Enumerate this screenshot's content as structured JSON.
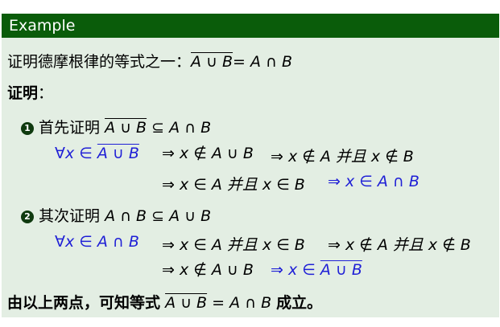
{
  "header": {
    "title": "Example"
  },
  "intro": {
    "text": "证明德摩根律的等式之一：",
    "lhs": "A ∪ B",
    "rhs": "= A ∩ B"
  },
  "proof_label": "证明",
  "proof_colon": "：",
  "step1": {
    "number": "1",
    "text": "首先证明",
    "expr_a": "A ∪ B",
    "expr_b": "⊆ A ∩ B",
    "row1": {
      "forall": "∀x ∈",
      "set": "A ∪ B",
      "impl1": "⇒ x ∉ A ∪ B",
      "impl2": "⇒ x ∉ A 并且 x ∉ B"
    },
    "row2": {
      "impl1": "⇒ x ∈ A 并且 x ∈ B",
      "impl2": "⇒ x ∈ A ∩ B"
    }
  },
  "step2": {
    "number": "2",
    "text": "其次证明",
    "expr_a": "A ∩ B",
    "expr_b": "⊆ A ∪ B",
    "row1": {
      "forall": "∀x ∈ A ∩ B",
      "impl1": "⇒ x ∈ A 并且 x ∈ B",
      "impl2": "⇒ x ∉ A 并且 x ∉ B"
    },
    "row2": {
      "impl1": "⇒ x ∉ A ∪ B",
      "impl2": "⇒ x ∈",
      "set": "A ∪ B"
    }
  },
  "conclusion": {
    "text": "由以上两点，可知等式",
    "lhs": "A ∪ B",
    "rhs": "= A ∩ B",
    "tail": "成立。"
  }
}
